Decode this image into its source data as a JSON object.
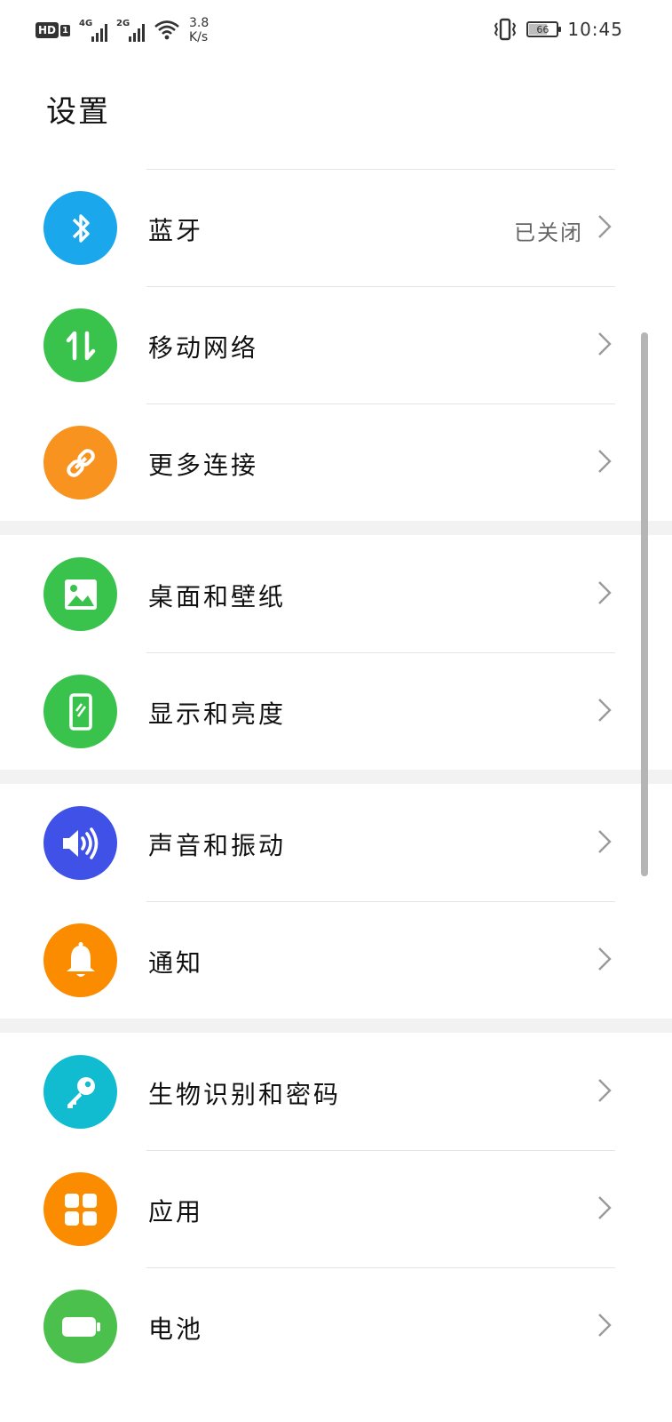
{
  "status_bar": {
    "hd_label": "HD",
    "sim_index": "1",
    "net1": "4G",
    "net2": "2G",
    "speed_value": "3.8",
    "speed_unit": "K/s",
    "battery": "66",
    "time": "10:45"
  },
  "header": {
    "title": "设置"
  },
  "groups": [
    {
      "items": [
        {
          "label": "蓝牙",
          "value": "已关闭",
          "icon": "bluetooth-icon",
          "color": "#1aa7ec"
        },
        {
          "label": "移动网络",
          "icon": "mobile-data-icon",
          "color": "#3ac34c"
        },
        {
          "label": "更多连接",
          "icon": "link-icon",
          "color": "#f7931e"
        }
      ]
    },
    {
      "items": [
        {
          "label": "桌面和壁纸",
          "icon": "wallpaper-icon",
          "color": "#3ac34c"
        },
        {
          "label": "显示和亮度",
          "icon": "display-icon",
          "color": "#3ac34c"
        }
      ]
    },
    {
      "items": [
        {
          "label": "声音和振动",
          "icon": "sound-icon",
          "color": "#3f51e6"
        },
        {
          "label": "通知",
          "icon": "bell-icon",
          "color": "#fb8c00"
        }
      ]
    },
    {
      "items": [
        {
          "label": "生物识别和密码",
          "icon": "key-icon",
          "color": "#12bcd0"
        },
        {
          "label": "应用",
          "icon": "apps-icon",
          "color": "#fb8c00"
        },
        {
          "label": "电池",
          "icon": "battery-icon",
          "color": "#4cc04c"
        }
      ]
    }
  ]
}
